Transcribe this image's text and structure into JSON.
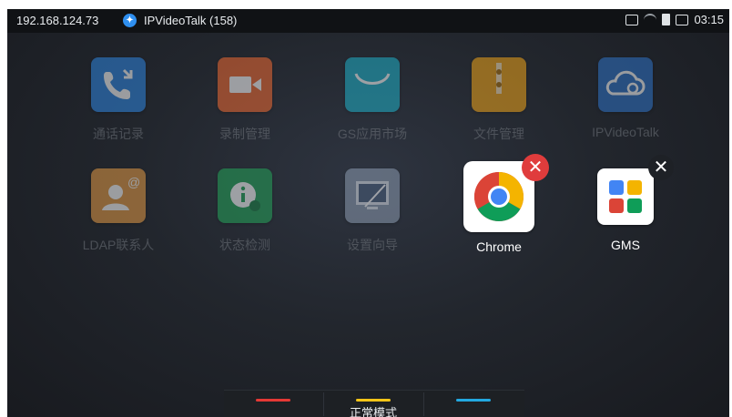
{
  "status_bar": {
    "ip": "192.168.124.73",
    "account_name": "IPVideoTalk (158)",
    "time": "03:15",
    "icons": [
      "network-icon",
      "wifi-off-icon",
      "sd-card-icon",
      "display-icon"
    ]
  },
  "apps": [
    {
      "label": "通话记录",
      "icon": "call-log-icon",
      "color": "#2f86e0"
    },
    {
      "label": "录制管理",
      "icon": "record-manager-icon",
      "color": "#f06a33"
    },
    {
      "label": "GS应用市场",
      "icon": "app-market-icon",
      "color": "#1fb0c8"
    },
    {
      "label": "文件管理",
      "icon": "file-manager-icon",
      "color": "#f0a419"
    },
    {
      "label": "IPVideoTalk",
      "icon": "ipvideotalk-icon",
      "color": "#2f73c7"
    },
    {
      "label": "LDAP联系人",
      "icon": "ldap-contact-icon",
      "color": "#e39a45"
    },
    {
      "label": "状态检测",
      "icon": "status-check-icon",
      "color": "#25a45a"
    },
    {
      "label": "设置向导",
      "icon": "setup-wizard-icon",
      "color": "#8c9bb0"
    },
    {
      "label": "Chrome",
      "icon": "chrome-icon",
      "color": "#ffffff"
    },
    {
      "label": "GMS",
      "icon": "gms-icon",
      "color": "#ffffff"
    }
  ],
  "dock": {
    "mode_label": "正常模式",
    "bar_colors": [
      "#e53935",
      "#f5c518",
      "#23a8e0"
    ]
  },
  "badges": {
    "chrome_remove": "✕",
    "gms_remove": "✕"
  }
}
